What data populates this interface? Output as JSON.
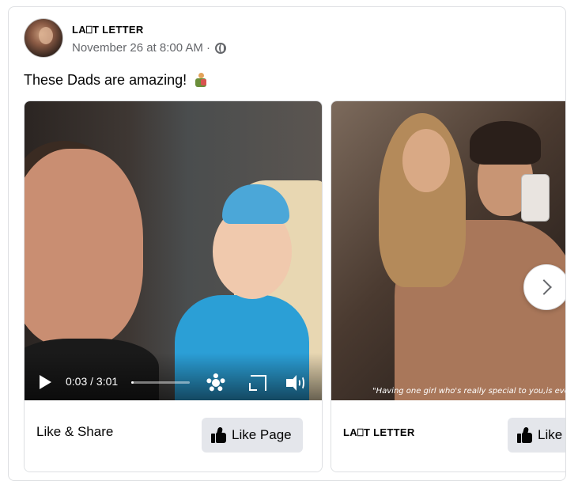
{
  "post": {
    "page_name": "LA⎕T LETTER",
    "timestamp": "November 26 at 8:00 AM",
    "separator": "·",
    "privacy_icon": "globe-icon",
    "text": "These Dads are amazing!",
    "emoji_icon": "man-holding-child-emoji"
  },
  "carousel": {
    "cards": [
      {
        "type": "video",
        "video": {
          "time_label": "0:03 / 3:01",
          "progress_fraction": 0.017
        },
        "footer_title": "Like & Share",
        "button_label": "Like Page"
      },
      {
        "type": "photo",
        "caption": "\"Having one girl who's  really special to you,is everythin",
        "footer_title": "LA⎕T LETTER",
        "button_label": "Like P"
      }
    ],
    "next_icon": "chevron-right-icon"
  },
  "colors": {
    "secondary_text": "#65676b",
    "button_bg": "#e4e6eb",
    "border": "#dddfe2"
  }
}
